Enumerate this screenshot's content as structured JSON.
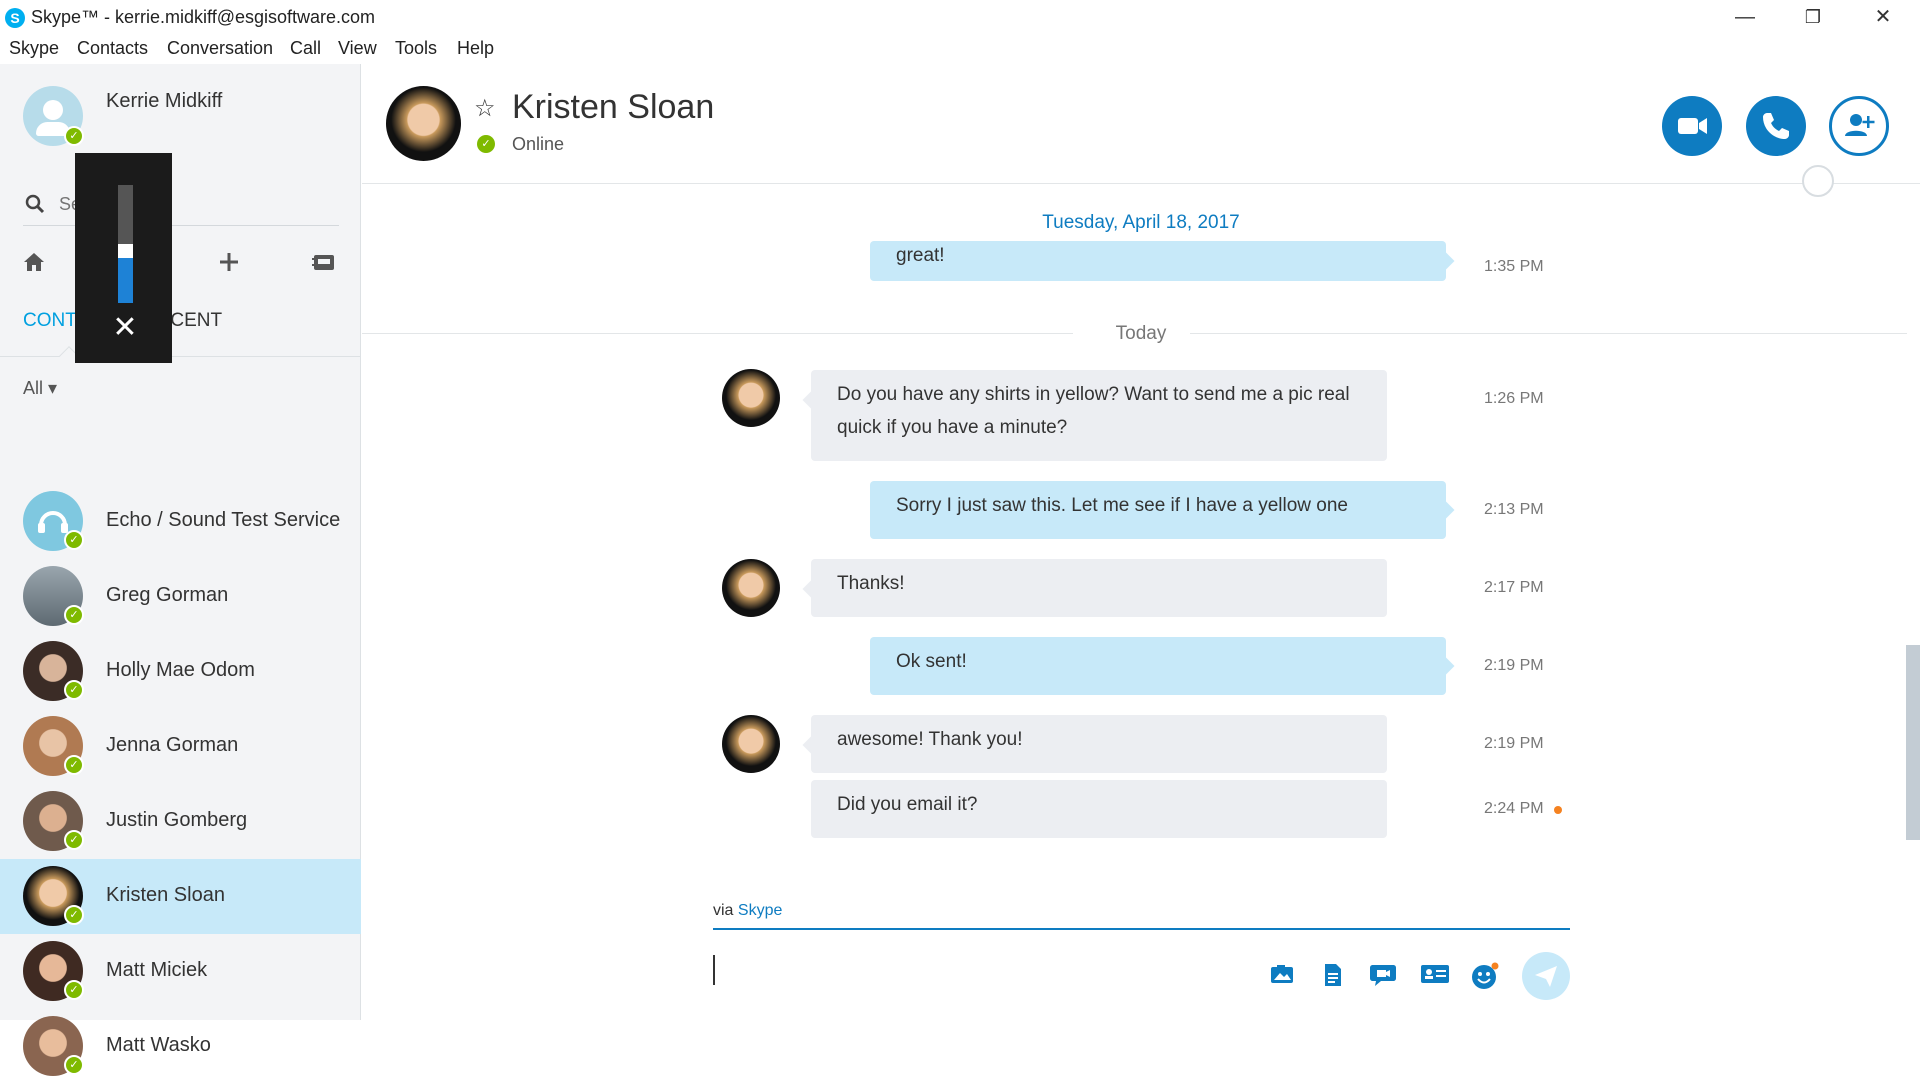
{
  "window": {
    "title": "Skype™ - kerrie.midkiff@esgisoftware.com",
    "logo_letter": "S",
    "minimize": "—",
    "restore": "❐",
    "close": "✕"
  },
  "menu": [
    {
      "label": "Skype"
    },
    {
      "label": "Contacts"
    },
    {
      "label": "Conversation"
    },
    {
      "label": "Call"
    },
    {
      "label": "View"
    },
    {
      "label": "Tools"
    },
    {
      "label": "Help"
    }
  ],
  "sidebar": {
    "me_name": "Kerrie Midkiff",
    "me_status": "✓",
    "search_placeholder": "Search",
    "volume_level": 0.38,
    "volume_close": "✕",
    "nav": {
      "home": "⌂",
      "dialpad": "⠿",
      "add": "+",
      "contacts_book": "▣"
    },
    "tabs": {
      "contacts": "CONTACTS",
      "recent": "RECENT"
    },
    "filter": "All ▾",
    "contacts": [
      {
        "name": "Echo / Sound Test Service",
        "status": "✓",
        "avatar_color": "#7fc8e0"
      },
      {
        "name": "Greg Gorman",
        "status": "✓",
        "avatar_color": "#6d7a84"
      },
      {
        "name": "Holly Mae Odom",
        "status": "✓",
        "avatar_color": "#4a3a34"
      },
      {
        "name": "Jenna Gorman",
        "status": "✓",
        "avatar_color": "#a56a4a"
      },
      {
        "name": "Justin Gomberg",
        "status": "✓",
        "avatar_color": "#7b5d4d"
      },
      {
        "name": "Kristen Sloan",
        "status": "✓",
        "avatar_color": "#111111",
        "selected": true
      },
      {
        "name": "Matt Miciek",
        "status": "✓",
        "avatar_color": "#5c3a2e"
      },
      {
        "name": "Matt Wasko",
        "status": "✓",
        "avatar_color": "#8a6550"
      }
    ]
  },
  "header": {
    "name": "Kristen Sloan",
    "star": "☆",
    "status": "Online",
    "status_check": "✓",
    "video_icon": "■",
    "call_icon": "✆",
    "add_people_icon": "+"
  },
  "conversation": {
    "date_old": "Tuesday, April 18, 2017",
    "date_today": "Today",
    "messages": [
      {
        "from": "me",
        "text": "great!",
        "time": "1:35 PM"
      },
      {
        "from": "them",
        "text": "Do you have any shirts in yellow?  Want to send me a pic real quick if you have a minute?",
        "time": "1:26 PM"
      },
      {
        "from": "me",
        "text": "Sorry I just saw this. Let me see if I have a yellow one",
        "time": "2:13 PM"
      },
      {
        "from": "them",
        "text": "Thanks!",
        "time": "2:17 PM"
      },
      {
        "from": "me",
        "text": "Ok sent!",
        "time": "2:19 PM"
      },
      {
        "from": "them",
        "text": "awesome!  Thank you!",
        "time": "2:19 PM"
      },
      {
        "from": "them",
        "text": "Did you email it?",
        "time": "2:24 PM"
      }
    ]
  },
  "compose": {
    "via_prefix": "via ",
    "via_app": "Skype",
    "input_value": "",
    "icons": {
      "photo": "▥",
      "file": "▤",
      "video_message": "◉",
      "contact_card": "▦",
      "emoticon": "☺",
      "send": "➤"
    }
  },
  "colors": {
    "accent": "#0e7cc1",
    "mine_bubble": "#c7e9f9",
    "their_bubble": "#eceef2",
    "online": "#7fba00",
    "unread": "#f58220"
  }
}
